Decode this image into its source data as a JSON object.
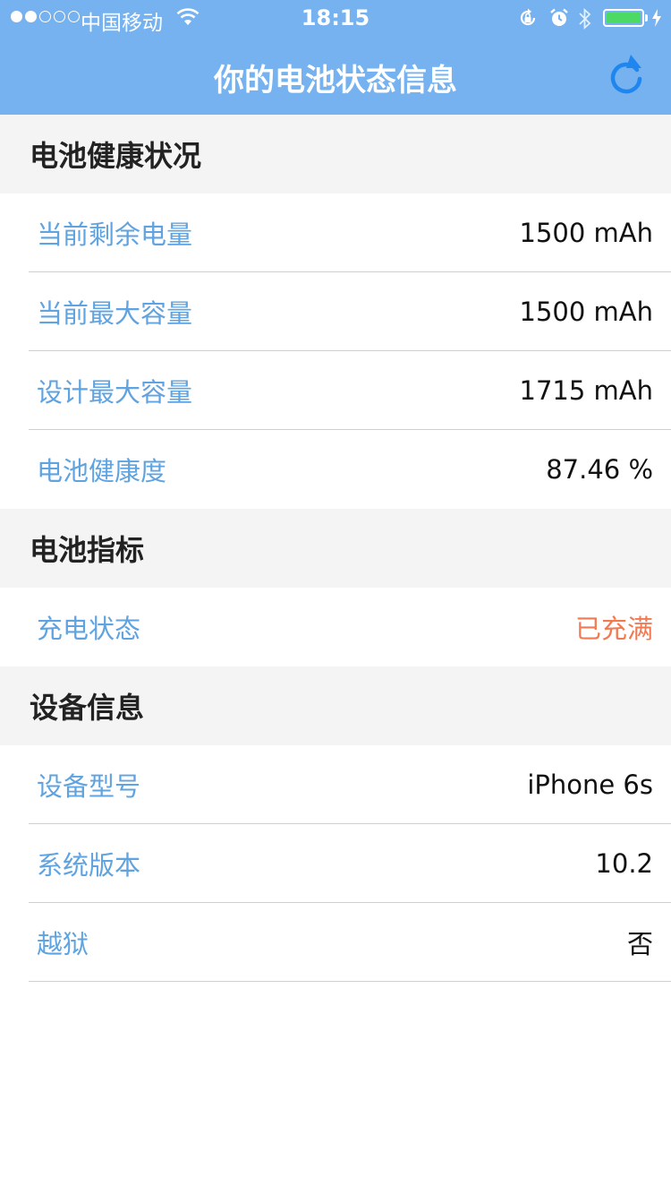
{
  "status_bar": {
    "carrier": "中国移动",
    "time": "18:15",
    "battery_level": 1.0,
    "charging": true
  },
  "nav": {
    "title": "你的电池状态信息",
    "refresh_icon": "refresh-icon"
  },
  "colors": {
    "header_bg": "#75b2ef",
    "section_bg": "#f4f4f4",
    "label": "#5fa3e0",
    "value": "#111111",
    "highlight": "#f27a53",
    "refresh": "#1f86f0"
  },
  "sections": [
    {
      "title": "电池健康状况",
      "rows": [
        {
          "label": "当前剩余电量",
          "value": "1500 mAh"
        },
        {
          "label": "当前最大容量",
          "value": "1500 mAh"
        },
        {
          "label": "设计最大容量",
          "value": "1715 mAh"
        },
        {
          "label": "电池健康度",
          "value": "87.46 %"
        }
      ]
    },
    {
      "title": "电池指标",
      "rows": [
        {
          "label": "充电状态",
          "value": "已充满"
        }
      ]
    },
    {
      "title": "设备信息",
      "rows": [
        {
          "label": "设备型号",
          "value": "iPhone 6s"
        },
        {
          "label": "系统版本",
          "value": "10.2"
        },
        {
          "label": "越狱",
          "value": "否"
        }
      ]
    }
  ]
}
